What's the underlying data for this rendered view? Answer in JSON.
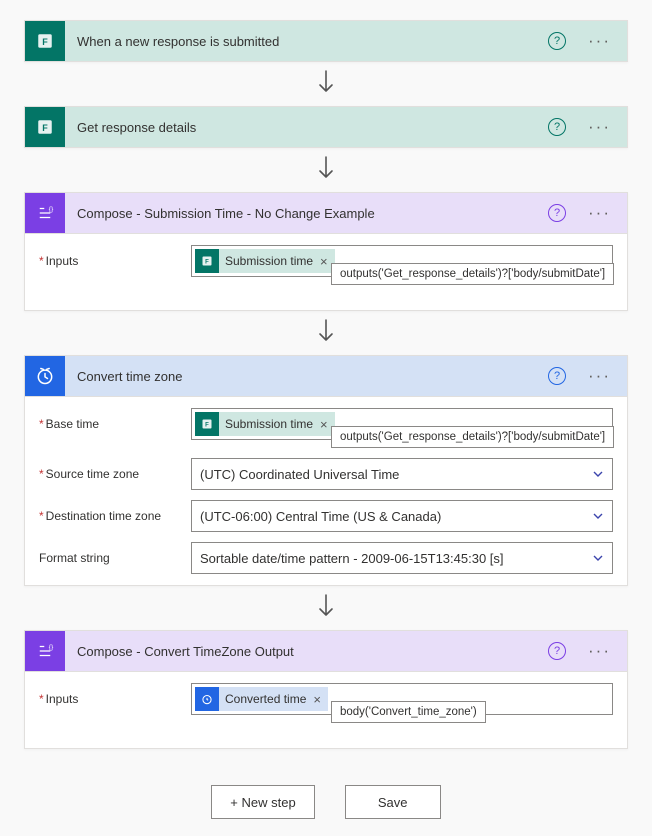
{
  "cards": {
    "trigger": {
      "title": "When a new response is submitted"
    },
    "get_details": {
      "title": "Get response details"
    },
    "compose1": {
      "title": "Compose - Submission Time - No Change Example",
      "inputs_label": "Inputs",
      "pill_label": "Submission time",
      "tooltip": "outputs('Get_response_details')?['body/submitDate']"
    },
    "convert": {
      "title": "Convert time zone",
      "base_time_label": "Base time",
      "base_time_pill": "Submission time",
      "base_time_tooltip": "outputs('Get_response_details')?['body/submitDate']",
      "source_tz_label": "Source time zone",
      "source_tz_value": "(UTC) Coordinated Universal Time",
      "dest_tz_label": "Destination time zone",
      "dest_tz_value": "(UTC-06:00) Central Time (US & Canada)",
      "format_label": "Format string",
      "format_value": "Sortable date/time pattern - 2009-06-15T13:45:30 [s]"
    },
    "compose2": {
      "title": "Compose - Convert TimeZone Output",
      "inputs_label": "Inputs",
      "pill_label": "Converted time",
      "tooltip": "body('Convert_time_zone')"
    }
  },
  "footer": {
    "new_step": "+ New step",
    "save": "Save"
  }
}
